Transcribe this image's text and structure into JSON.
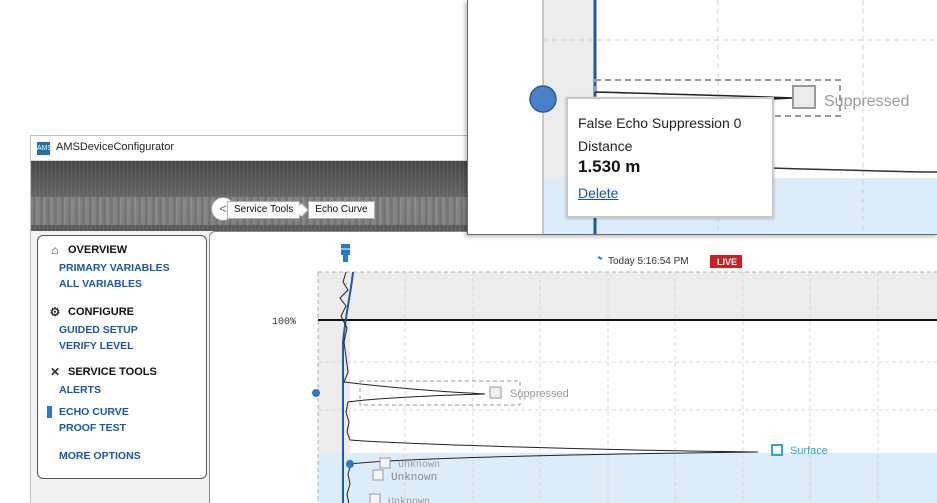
{
  "window": {
    "title": "AMSDeviceConfigurator",
    "logo_text": "AMS"
  },
  "breadcrumb": {
    "back": "<",
    "items": [
      "Service Tools",
      "Echo Curve"
    ]
  },
  "sidebar": {
    "sections": [
      {
        "title": "OVERVIEW",
        "icon": "home-icon",
        "items": [
          "PRIMARY VARIABLES",
          "ALL VARIABLES"
        ]
      },
      {
        "title": "CONFIGURE",
        "icon": "gear-icon",
        "items": [
          "GUIDED SETUP",
          "VERIFY LEVEL"
        ]
      },
      {
        "title": "SERVICE TOOLS",
        "icon": "tools-icon",
        "items": [
          "ALERTS",
          "ECHO CURVE",
          "PROOF TEST"
        ]
      }
    ],
    "more": "MORE OPTIONS",
    "active_item": "ECHO CURVE"
  },
  "chart": {
    "timestamp": "Today 5:16:54 PM",
    "live_label": "LIVE",
    "level_label": "100%",
    "markers": {
      "suppressed": "Suppressed",
      "surface": "Surface",
      "unknown": "Unknown"
    }
  },
  "zoom": {
    "suppressed_label": "Suppressed",
    "tooltip": {
      "title": "False Echo Suppression 0",
      "label": "Distance",
      "value": "1.530 m",
      "delete": "Delete"
    }
  },
  "colors": {
    "accent": "#1a56a6",
    "curve_blue": "#1f5a9e",
    "surface_marker": "#29a8e0",
    "live_red": "#cc2026",
    "fill_light_blue": "#dcedf9"
  }
}
